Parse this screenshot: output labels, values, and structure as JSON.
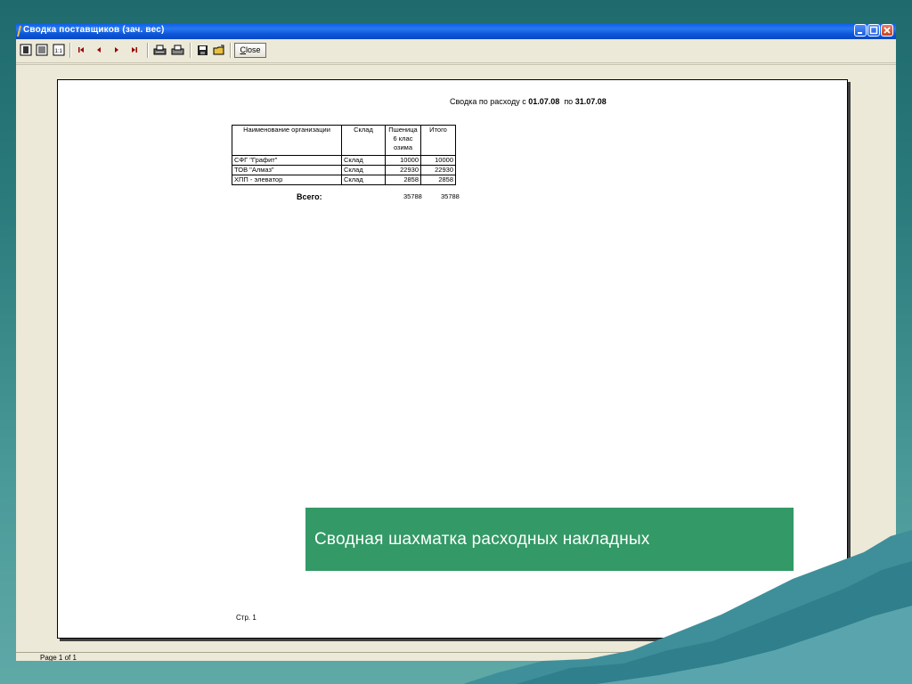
{
  "window": {
    "title": "Сводка поставщиков (зач. вес)",
    "controls": [
      "minimize",
      "maximize",
      "close"
    ]
  },
  "toolbar": {
    "buttons": [
      {
        "icon": "whole-page-icon"
      },
      {
        "icon": "page-width-icon"
      },
      {
        "icon": "zoom-100-icon"
      },
      {
        "icon": "first-page-icon"
      },
      {
        "icon": "prev-page-icon"
      },
      {
        "icon": "next-page-icon"
      },
      {
        "icon": "last-page-icon"
      },
      {
        "icon": "print-setup-icon"
      },
      {
        "icon": "print-icon"
      },
      {
        "icon": "save-icon"
      },
      {
        "icon": "open-icon"
      }
    ],
    "close_label_mnemonic": "C",
    "close_label_rest": "lose"
  },
  "report": {
    "title_prefix": "Сводка по расходу  с",
    "date_from": "01.07.08",
    "title_mid": "по",
    "date_to": "31.07.08",
    "columns": [
      "Наименование организации",
      "Склад",
      "Пшеница 6 клас озима",
      "Итого"
    ],
    "rows": [
      [
        "СФГ \"Графит\"",
        "Склад",
        "10000",
        "10000"
      ],
      [
        "ТОВ \"Алмаз\"",
        "Склад",
        "22930",
        "22930"
      ],
      [
        "ХПП - элеватор",
        "Склад",
        "2858",
        "2858"
      ]
    ],
    "total_label": "Всего:",
    "total_values": [
      "35788",
      "35788"
    ],
    "page_label": "Стр. 1"
  },
  "statusbar": {
    "text": "Page 1 of 1"
  },
  "caption": {
    "text": "Сводная шахматка расходных накладных"
  },
  "colors": {
    "titlebar": "#0a5ee8",
    "caption_bg": "#339966",
    "background": "#2b7b7c"
  }
}
